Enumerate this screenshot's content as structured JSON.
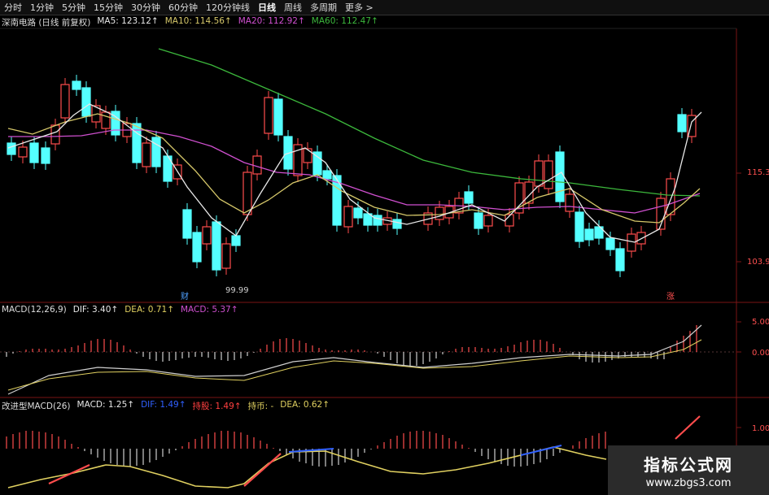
{
  "tabs": [
    "分时",
    "1分钟",
    "5分钟",
    "15分钟",
    "30分钟",
    "60分钟",
    "120分钟线",
    "日线",
    "周线",
    "多周期",
    "更多 >"
  ],
  "active_tab": "日线",
  "main_panel": {
    "stock_title": "深南电路 (日线 前复权)",
    "ma5": "MA5: 123.12↑",
    "ma10": "MA10: 114.56↑",
    "ma20": "MA20: 112.92↑",
    "ma60": "MA60: 112.47↑",
    "axis_labels": [
      "115.3",
      "103.9"
    ],
    "low_marker": "99.99",
    "markers": [
      "财",
      "涨"
    ]
  },
  "macd_panel": {
    "title": "MACD(12,26,9)",
    "dif": "DIF: 3.40↑",
    "dea": "DEA: 0.71↑",
    "macd": "MACD: 5.37↑",
    "axis_labels": [
      "5.00",
      "0.00"
    ]
  },
  "mod_panel": {
    "title": "改进型MACD(26)",
    "macd": "MACD: 1.25↑",
    "dif": "DIF: 1.49↑",
    "hold": "持股: 1.49↑",
    "coin": "持币: -",
    "dea": "DEA: 0.62↑",
    "axis_labels": [
      "1.00"
    ]
  },
  "colors": {
    "up": "#ff4d4d",
    "down": "#54ffff",
    "ma5": "#e8e8e8",
    "ma10": "#d6c86a",
    "ma20": "#d050d0",
    "ma60": "#3cb83c",
    "dif": "#cfcfcf",
    "dea": "#e0d060",
    "grid": "#7a1515"
  },
  "watermark": {
    "title": "指标公式网",
    "url": "www.zbgs3.com"
  }
}
